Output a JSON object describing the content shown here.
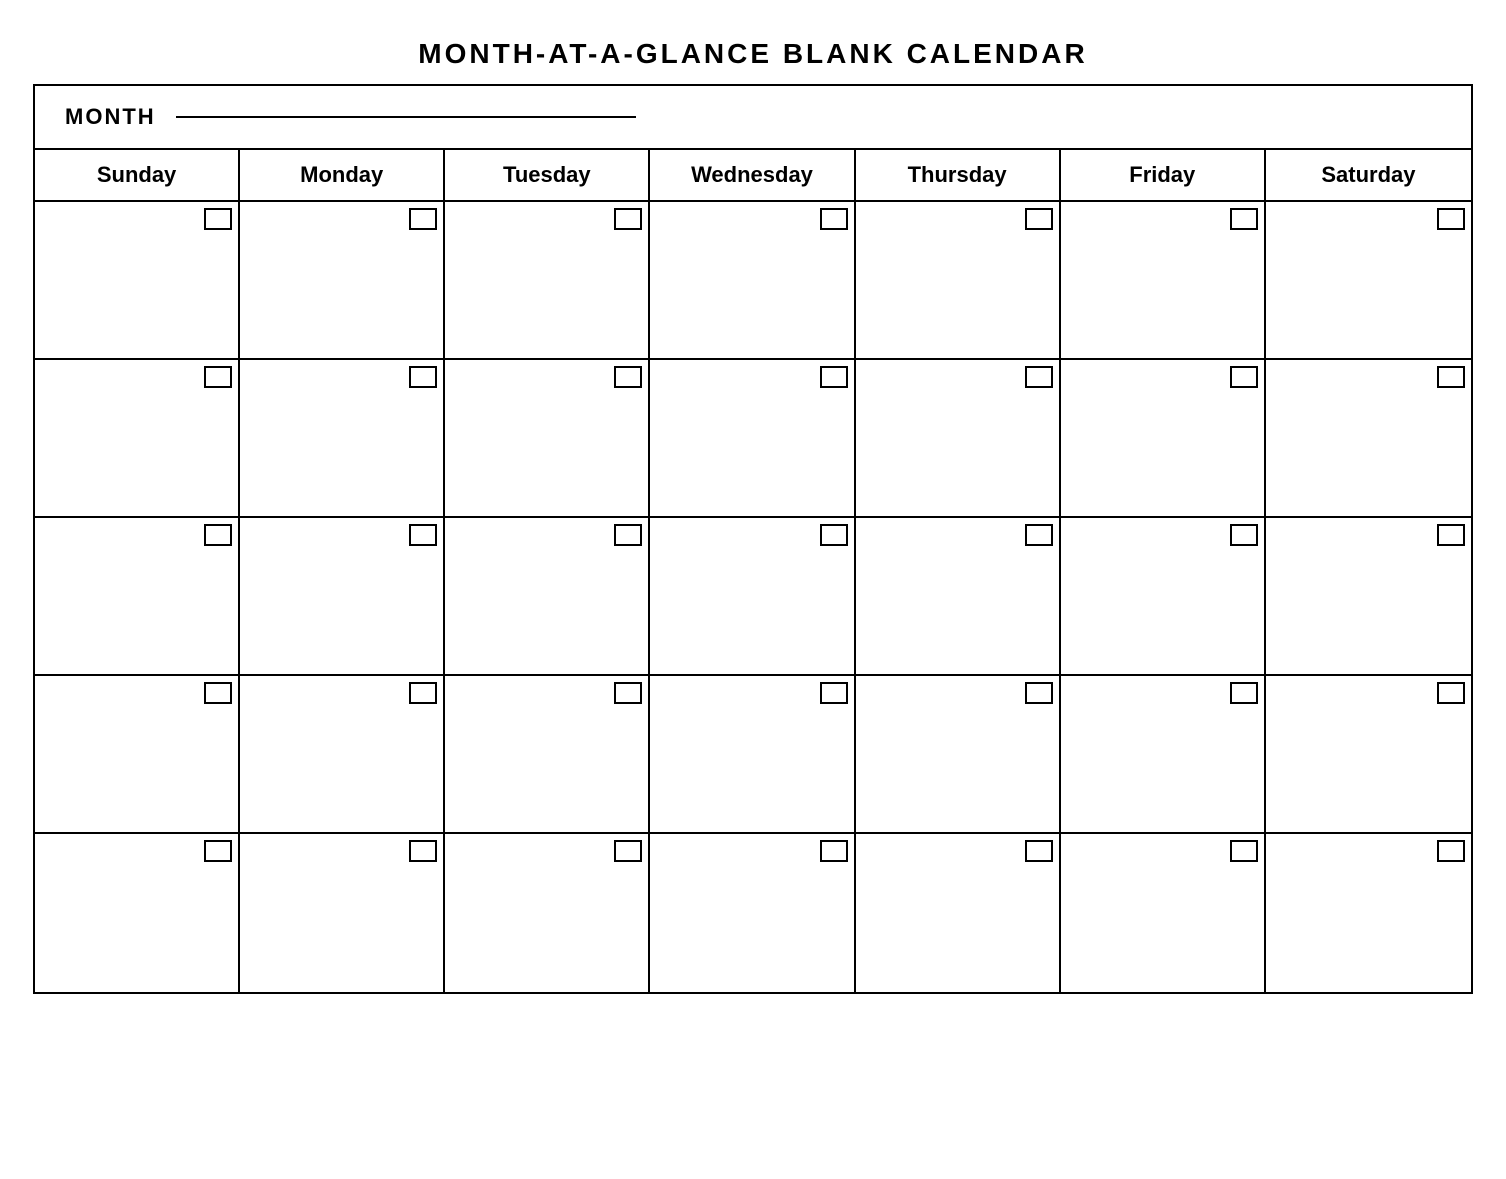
{
  "title": "MONTH-AT-A-GLANCE  BLANK  CALENDAR",
  "month_label": "MONTH",
  "days": [
    "Sunday",
    "Monday",
    "Tuesday",
    "Wednesday",
    "Thursday",
    "Friday",
    "Saturday"
  ],
  "rows": 5,
  "cols": 7
}
